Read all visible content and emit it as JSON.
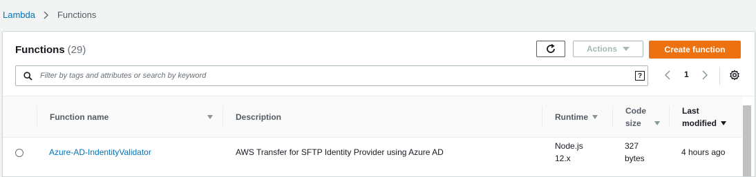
{
  "breadcrumb": {
    "root": "Lambda",
    "current": "Functions"
  },
  "panel": {
    "title": "Functions",
    "count": "(29)"
  },
  "buttons": {
    "actions": "Actions",
    "create": "Create function"
  },
  "search": {
    "placeholder": "Filter by tags and attributes or search by keyword",
    "help": "?"
  },
  "pagination": {
    "page": "1"
  },
  "columns": {
    "name": "Function name",
    "description": "Description",
    "runtime": "Runtime",
    "code_size_line1": "Code",
    "code_size_line2": "size",
    "last_modified_line1": "Last",
    "last_modified_line2": "modified"
  },
  "rows": [
    {
      "name": "Azure-AD-IndentityValidator",
      "description": "AWS Transfer for SFTP Identity Provider using Azure AD",
      "runtime_line1": "Node.js",
      "runtime_line2": "12.x",
      "code_size_line1": "327",
      "code_size_line2": "bytes",
      "last_modified": "4 hours ago"
    }
  ],
  "colors": {
    "link": "#0073bb",
    "primary": "#ec7211",
    "border": "#aab7b8"
  }
}
